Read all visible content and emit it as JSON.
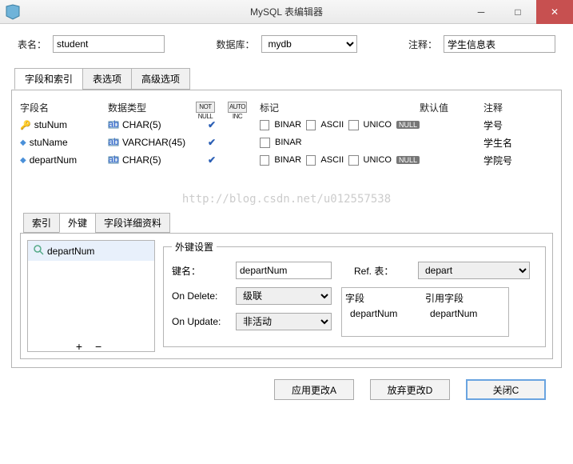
{
  "titlebar": {
    "title": "MySQL 表编辑器"
  },
  "labels": {
    "table_name": "表名：",
    "database": "数据库：",
    "comment": "注释："
  },
  "values": {
    "table_name": "student",
    "database": "mydb",
    "comment": "学生信息表"
  },
  "main_tabs": [
    "字段和索引",
    "表选项",
    "高级选项"
  ],
  "grid_headers": {
    "name": "字段名",
    "type": "数据类型",
    "nn": "NOT NULL",
    "ai": "AUTO INC",
    "flags": "标记",
    "default": "默认值",
    "comment": "注释"
  },
  "columns": [
    {
      "icon": "key",
      "name": "stuNum",
      "type": "CHAR(5)",
      "nn": true,
      "flags": [
        "BINARY",
        "ASCII",
        "UNICODE"
      ],
      "default_null": true,
      "comment": "学号"
    },
    {
      "icon": "col",
      "name": "stuName",
      "type": "VARCHAR(45)",
      "nn": true,
      "flags": [
        "BINARY"
      ],
      "default_null": false,
      "comment": "学生名"
    },
    {
      "icon": "col",
      "name": "departNum",
      "type": "CHAR(5)",
      "nn": true,
      "flags": [
        "BINARY",
        "ASCII",
        "UNICODE"
      ],
      "default_null": true,
      "comment": "学院号"
    }
  ],
  "watermark": "http://blog.csdn.net/u012557538",
  "sub_tabs": [
    "索引",
    "外键",
    "字段详细资料"
  ],
  "fk_list": [
    "departNum"
  ],
  "fk_settings": {
    "legend": "外键设置",
    "key_name_lbl": "键名：",
    "key_name": "departNum",
    "ref_table_lbl": "Ref. 表：",
    "ref_table": "depart",
    "on_delete_lbl": "On Delete:",
    "on_delete": "级联",
    "on_update_lbl": "On Update:",
    "on_update": "非活动",
    "col_hdr": "字段",
    "refcol_hdr": "引用字段",
    "col": "departNum",
    "refcol": "departNum"
  },
  "buttons": {
    "apply": "应用更改A",
    "discard": "放弃更改D",
    "close": "关闭C"
  }
}
